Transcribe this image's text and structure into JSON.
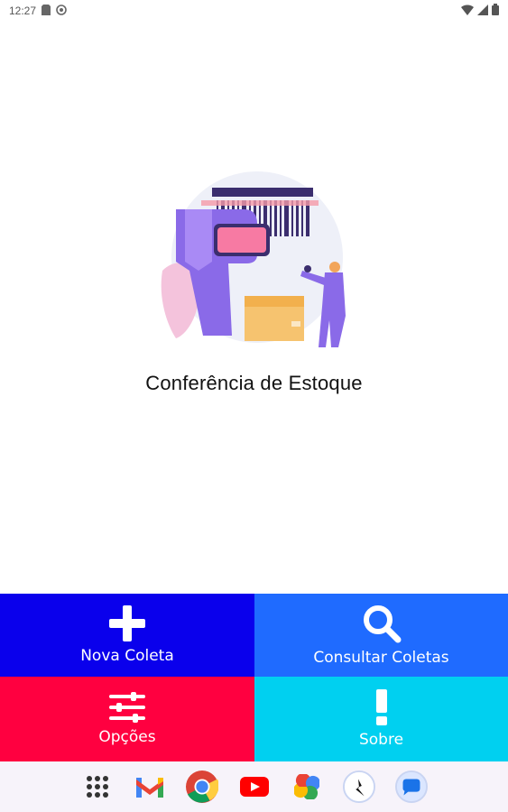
{
  "status_bar": {
    "time": "12:27"
  },
  "app": {
    "title": "Conferência de Estoque"
  },
  "actions": [
    {
      "label": "Nova Coleta",
      "color": "#0a00ec",
      "icon": "plus-icon"
    },
    {
      "label": "Consultar Coletas",
      "color": "#1f6bff",
      "icon": "search-icon"
    },
    {
      "label": "Opções",
      "color": "#ff0040",
      "icon": "sliders-icon"
    },
    {
      "label": "Sobre",
      "color": "#00d0f0",
      "icon": "exclamation-icon"
    }
  ],
  "dock": {
    "apps": [
      "app-drawer-icon",
      "gmail-icon",
      "chrome-icon",
      "youtube-icon",
      "photos-icon",
      "app-icon",
      "messages-icon"
    ]
  }
}
